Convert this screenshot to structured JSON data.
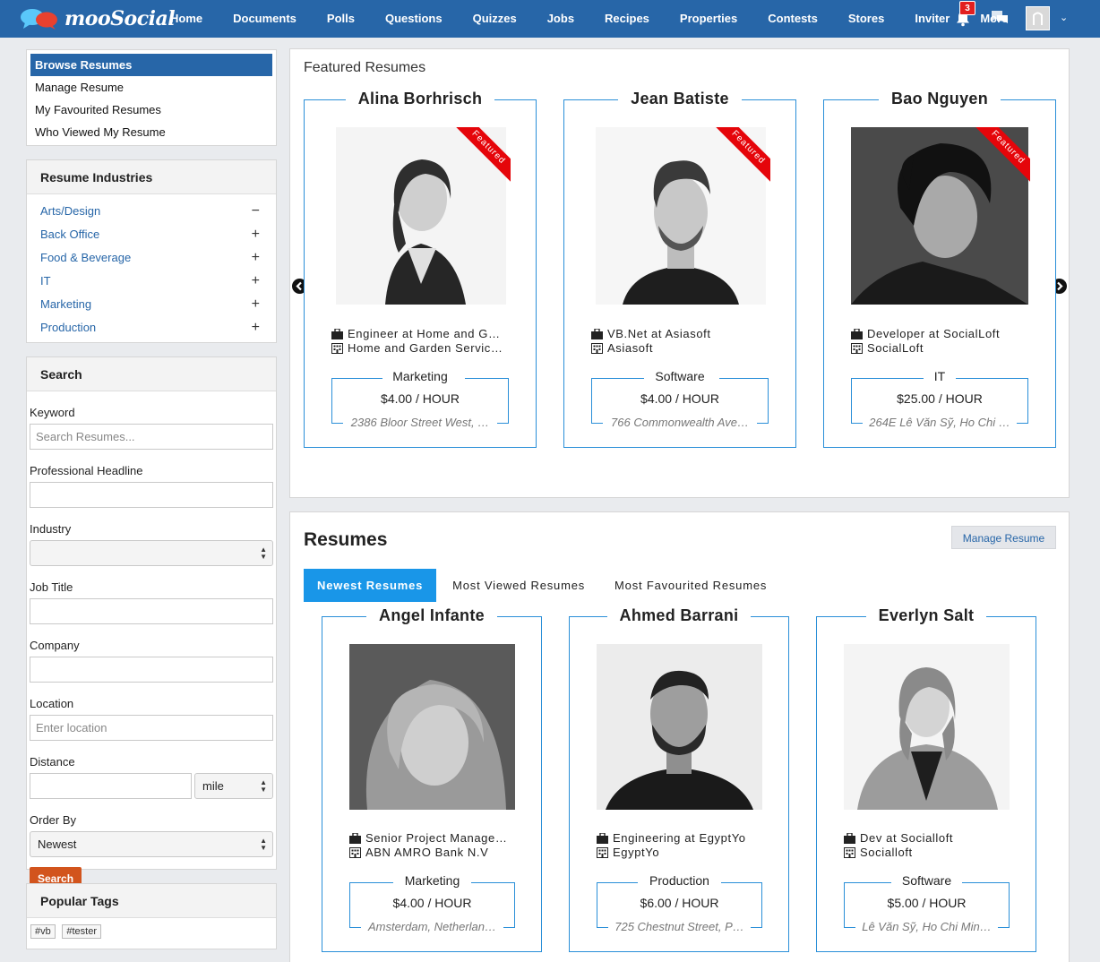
{
  "brand": {
    "name": "mooSocial"
  },
  "nav": [
    "Home",
    "Documents",
    "Polls",
    "Questions",
    "Quizzes",
    "Jobs",
    "Recipes",
    "Properties",
    "Contests",
    "Stores",
    "Inviter",
    "More"
  ],
  "notifications": {
    "count": "3"
  },
  "side_menu": [
    "Browse Resumes",
    "Manage Resume",
    "My Favourited Resumes",
    "Who Viewed My Resume"
  ],
  "industries": {
    "title": "Resume Industries",
    "items": [
      {
        "label": "Arts/Design",
        "toggle": "−"
      },
      {
        "label": "Back Office",
        "toggle": "+"
      },
      {
        "label": "Food & Beverage",
        "toggle": "+"
      },
      {
        "label": "IT",
        "toggle": "+"
      },
      {
        "label": "Marketing",
        "toggle": "+"
      },
      {
        "label": "Production",
        "toggle": "+"
      }
    ]
  },
  "search": {
    "title": "Search",
    "keyword_label": "Keyword",
    "keyword_placeholder": "Search Resumes...",
    "headline_label": "Professional Headline",
    "industry_label": "Industry",
    "industry_value": "",
    "jobtitle_label": "Job Title",
    "company_label": "Company",
    "location_label": "Location",
    "location_placeholder": "Enter location",
    "distance_label": "Distance",
    "distance_unit": "mile",
    "order_label": "Order By",
    "order_value": "Newest",
    "button": "Search"
  },
  "tags": {
    "title": "Popular Tags",
    "items": [
      "#vb",
      "#tester"
    ]
  },
  "featured": {
    "title": "Featured Resumes",
    "ribbon": "Featured",
    "cards": [
      {
        "name": "Alina Borhrisch",
        "job": "Engineer at Home and G…",
        "company": "Home and Garden Servic…",
        "industry": "Marketing",
        "rate": "$4.00 / HOUR",
        "location": "2386 Bloor Street West, …"
      },
      {
        "name": "Jean Batiste",
        "job": "VB.Net at Asiasoft",
        "company": "Asiasoft",
        "industry": "Software",
        "rate": "$4.00 / HOUR",
        "location": "766 Commonwealth Ave…"
      },
      {
        "name": "Bao Nguyen",
        "job": "Developer at SocialLoft",
        "company": "SocialLoft",
        "industry": "IT",
        "rate": "$25.00 / HOUR",
        "location": "264E Lê Văn Sỹ, Ho Chi …"
      }
    ]
  },
  "resumes": {
    "title": "Resumes",
    "manage_button": "Manage Resume",
    "tabs": [
      "Newest Resumes",
      "Most Viewed Resumes",
      "Most Favourited Resumes"
    ],
    "cards": [
      {
        "name": "Angel Infante",
        "job": "Senior Project Manage…",
        "company": "ABN AMRO Bank N.V",
        "industry": "Marketing",
        "rate": "$4.00 / HOUR",
        "location": "Amsterdam, Netherlan…"
      },
      {
        "name": "Ahmed Barrani",
        "job": "Engineering at EgyptYo",
        "company": "EgyptYo",
        "industry": "Production",
        "rate": "$6.00 / HOUR",
        "location": "725 Chestnut Street, P…"
      },
      {
        "name": "Everlyn Salt",
        "job": "Dev at Socialloft",
        "company": "Socialloft",
        "industry": "Software",
        "rate": "$5.00 / HOUR",
        "location": "Lê Văn Sỹ, Ho Chi Min…"
      }
    ]
  }
}
